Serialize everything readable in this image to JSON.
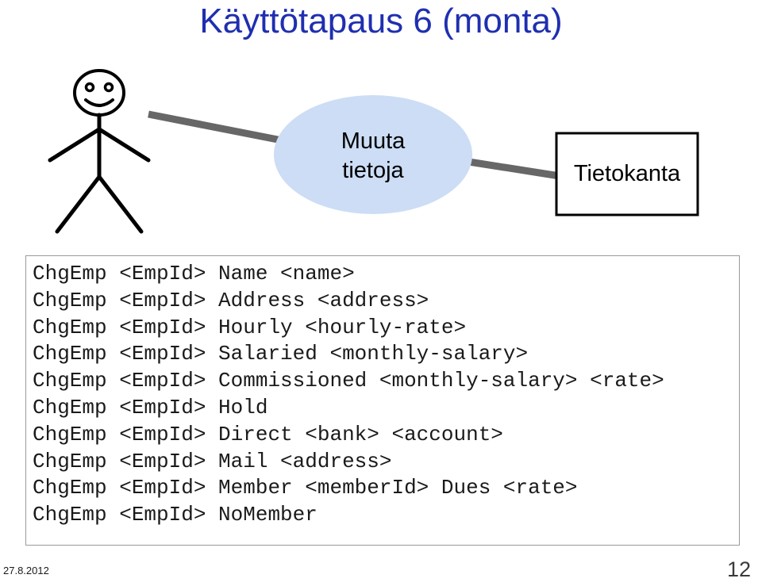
{
  "slide": {
    "title": "Käyttötapaus 6 (monta)",
    "title_color": "#1f2fb0"
  },
  "diagram": {
    "actor": {
      "name": "stick-figure-actor"
    },
    "use_case": {
      "label_line1": "Muuta",
      "label_line2": "tietoja",
      "fill_color": "#ccddf5"
    },
    "system_box": {
      "label": "Tietokanta",
      "border_color": "#000000"
    },
    "connector_color": "#676767"
  },
  "code": {
    "lines": [
      "ChgEmp <EmpId> Name <name>",
      "ChgEmp <EmpId> Address <address>",
      "ChgEmp <EmpId> Hourly <hourly-rate>",
      "ChgEmp <EmpId> Salaried <monthly-salary>",
      "ChgEmp <EmpId> Commissioned <monthly-salary> <rate>",
      "ChgEmp <EmpId> Hold",
      "ChgEmp <EmpId> Direct <bank> <account>",
      "ChgEmp <EmpId> Mail <address>",
      "ChgEmp <EmpId> Member <memberId> Dues <rate>",
      "ChgEmp <EmpId> NoMember"
    ]
  },
  "footer": {
    "date": "27.8.2012",
    "page_number": "12"
  }
}
